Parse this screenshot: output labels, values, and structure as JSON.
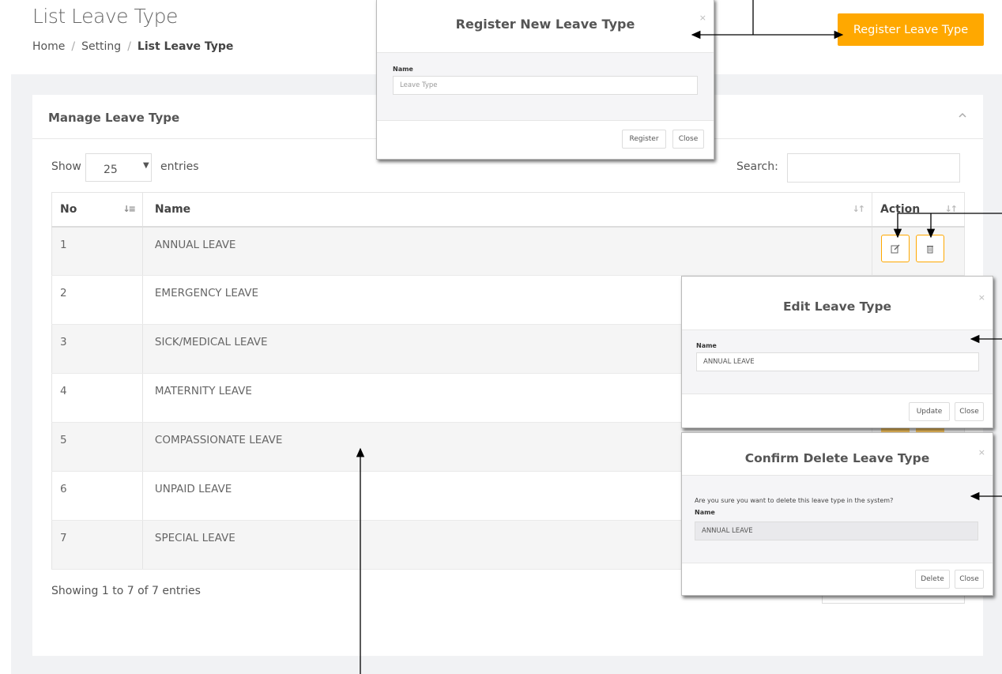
{
  "page": {
    "title": "List Leave Type",
    "breadcrumb": [
      "Home",
      "Setting",
      "List Leave Type"
    ],
    "register_button": "Register Leave Type"
  },
  "card": {
    "title": "Manage Leave Type"
  },
  "controls": {
    "show_label": "Show",
    "show_value": "25",
    "entries_label": "entries",
    "search_label": "Search:"
  },
  "table": {
    "headers": [
      "No",
      "Name",
      "Action"
    ],
    "rows": [
      {
        "no": "1",
        "name": "ANNUAL LEAVE"
      },
      {
        "no": "2",
        "name": "EMERGENCY LEAVE"
      },
      {
        "no": "3",
        "name": "SICK/MEDICAL LEAVE"
      },
      {
        "no": "4",
        "name": "MATERNITY LEAVE"
      },
      {
        "no": "5",
        "name": "COMPASSIONATE LEAVE"
      },
      {
        "no": "6",
        "name": "UNPAID LEAVE"
      },
      {
        "no": "7",
        "name": "SPECIAL LEAVE"
      }
    ],
    "footer": "Showing 1 to 7 of 7 entries"
  },
  "register_modal": {
    "title": "Register New Leave Type",
    "close_x": "×",
    "label": "Name",
    "placeholder": "Leave Type",
    "submit": "Register",
    "close": "Close"
  },
  "edit_modal": {
    "title": "Edit Leave Type",
    "close_x": "×",
    "label": "Name",
    "value": "ANNUAL LEAVE",
    "submit": "Update",
    "close": "Close"
  },
  "delete_modal": {
    "title": "Confirm Delete Leave Type",
    "close_x": "×",
    "message": "Are you sure you want to delete this leave type in the system?",
    "label": "Name",
    "value": "ANNUAL LEAVE",
    "submit": "Delete",
    "close": "Close"
  },
  "colors": {
    "accent": "#ffa800",
    "background": "#f1f2f4"
  },
  "icons": [
    "edit-icon",
    "trash-icon",
    "chevron-up-icon",
    "sort-icon",
    "caret-down-icon"
  ]
}
